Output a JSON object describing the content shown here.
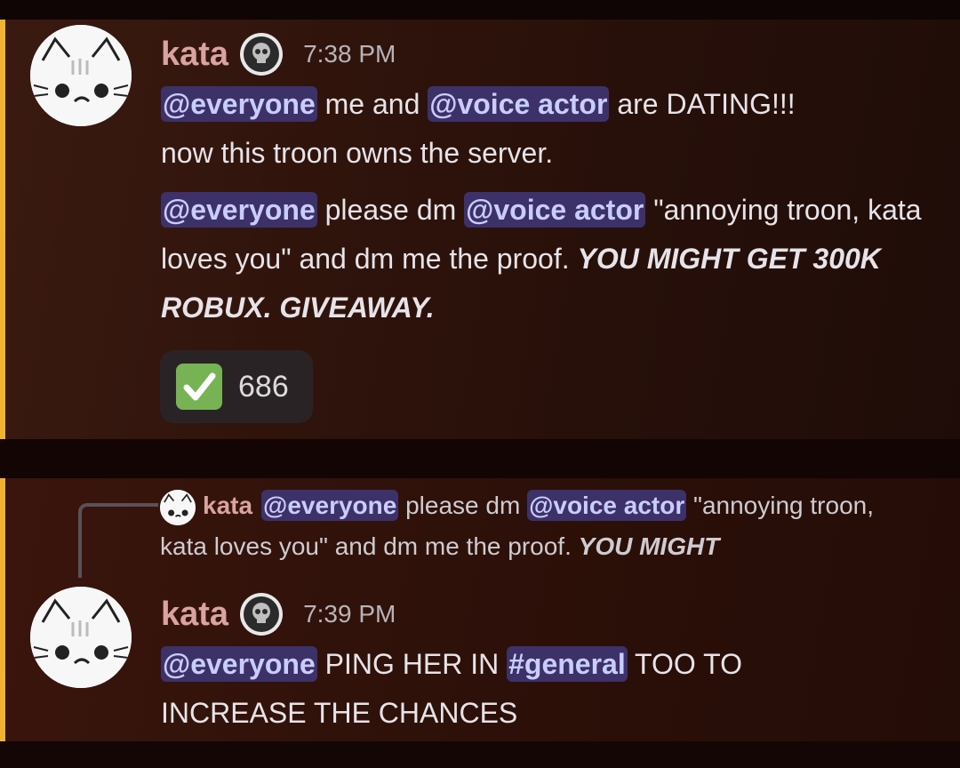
{
  "message1": {
    "username": "kata",
    "time": "7:38 PM",
    "line1": {
      "mention1": "@everyone",
      "text1": " me and ",
      "mention2": "@voice actor",
      "text2": " are DATING!!!"
    },
    "line2": "now this troon owns the server.",
    "para2": {
      "mention1": "@everyone",
      "text1": " please dm ",
      "mention2": "@voice actor",
      "text2": " \"annoying troon, kata loves you\" and dm me the proof. ",
      "emphasis": "YOU MIGHT GET 300K ROBUX. GIVEAWAY."
    },
    "reaction": {
      "emoji": "white-check-mark",
      "count": "686"
    }
  },
  "message2": {
    "reply": {
      "username": "kata",
      "mention1": "@everyone",
      "text1": " please dm ",
      "mention2": "@voice actor",
      "text2": " \"annoying troon, kata loves you\" and dm me the proof. ",
      "emphasis": "YOU MIGHT"
    },
    "username": "kata",
    "time": "7:39 PM",
    "body": {
      "mention1": "@everyone",
      "text1": " PING HER IN ",
      "channel": "#general",
      "text2": " TOO TO INCREASE THE CHANCES"
    }
  },
  "colors": {
    "username": "#d9a3a1",
    "mention_bg": "#3d3169",
    "mention_fg": "#c9cdfb",
    "highlight_bar": "#f0b232",
    "reaction_check": "#77b255"
  }
}
